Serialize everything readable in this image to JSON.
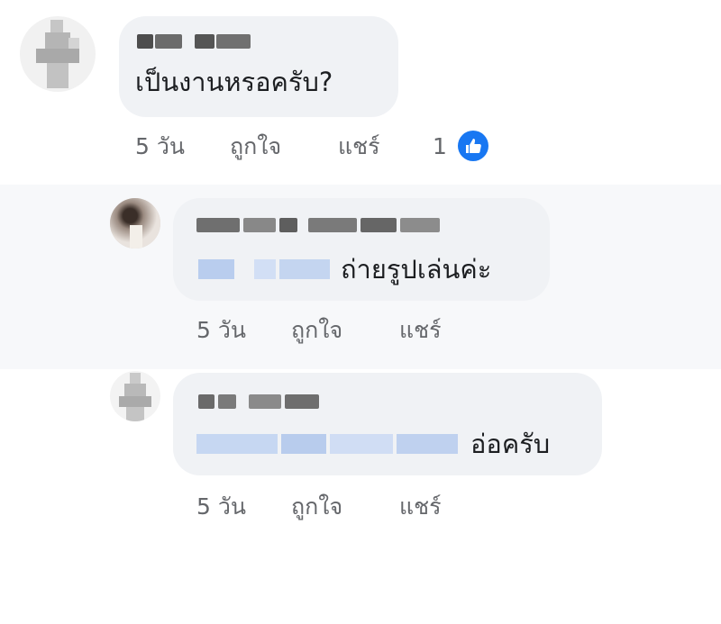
{
  "comments": [
    {
      "text": "เป็นงานหรอครับ?",
      "time": "5 วัน",
      "like_label": "ถูกใจ",
      "share_label": "แชร์",
      "reaction_count": "1"
    },
    {
      "text": "ถ่ายรูปเล่นค่ะ",
      "time": "5 วัน",
      "like_label": "ถูกใจ",
      "share_label": "แชร์"
    },
    {
      "text": "อ่อครับ",
      "time": "5 วัน",
      "like_label": "ถูกใจ",
      "share_label": "แชร์"
    }
  ],
  "colors": {
    "bubble": "#f0f2f5",
    "meta_text": "#65676b",
    "like_blue": "#1877f2",
    "mention_blur": "#c9d9f3"
  },
  "icons": [
    "like-reaction-icon"
  ]
}
